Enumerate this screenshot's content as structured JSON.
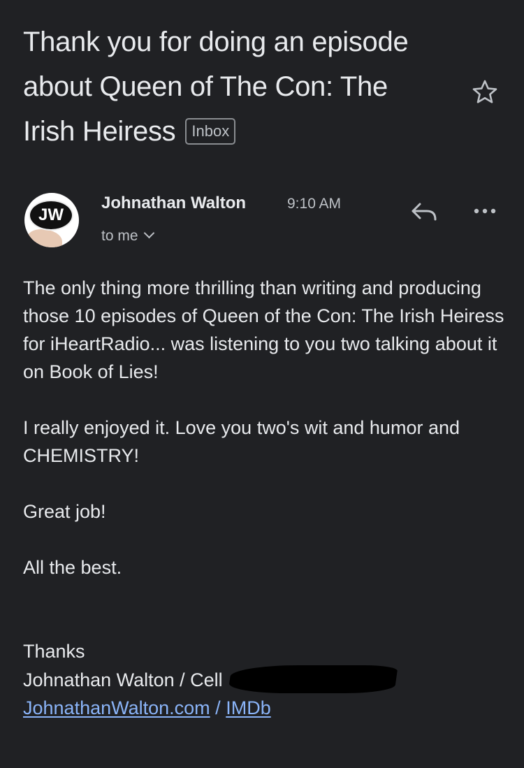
{
  "email": {
    "subject": "Thank you for doing an episode about Queen of The Con: The Irish Heiress",
    "label": "Inbox",
    "sender": {
      "name": "Johnathan Walton",
      "avatar_initials": "JW",
      "time": "9:10 AM",
      "recipient": "to me"
    },
    "body": [
      "The only thing more thrilling than writing and producing those 10 episodes of Queen of the Con: The Irish Heiress for iHeartRadio... was listening to you two talking about it on Book of Lies!",
      "I really enjoyed it. Love you two's wit and humor and CHEMISTRY!",
      "Great job!",
      "All the best."
    ],
    "signature": {
      "thanks": "Thanks",
      "name_line": "Johnathan Walton / Cell",
      "website_link": "JohnathanWalton.com",
      "separator": "/",
      "imdb_link": "IMDb"
    }
  },
  "icons": {
    "star": "star-outline-icon",
    "reply": "reply-icon",
    "more": "more-horizontal-icon",
    "chevron": "chevron-down-icon"
  },
  "colors": {
    "background": "#202124",
    "text": "#e8eaed",
    "secondary_text": "#bdc1c6",
    "link": "#8ab4f8"
  }
}
